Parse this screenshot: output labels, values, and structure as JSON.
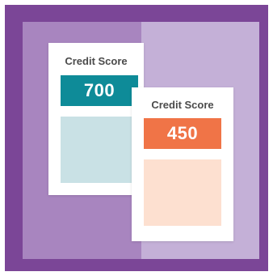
{
  "colors": {
    "frame": "#7b4697",
    "panel_left": "#a885bf",
    "panel_right": "#c4b0d7",
    "card": "#ffffff",
    "score_a_bg": "#0e8b98",
    "fill_a": "#c9e1e5",
    "score_b_bg": "#f07447",
    "fill_b": "#fde0d0"
  },
  "cards": [
    {
      "title": "Credit Score",
      "score": "700"
    },
    {
      "title": "Credit Score",
      "score": "450"
    }
  ]
}
